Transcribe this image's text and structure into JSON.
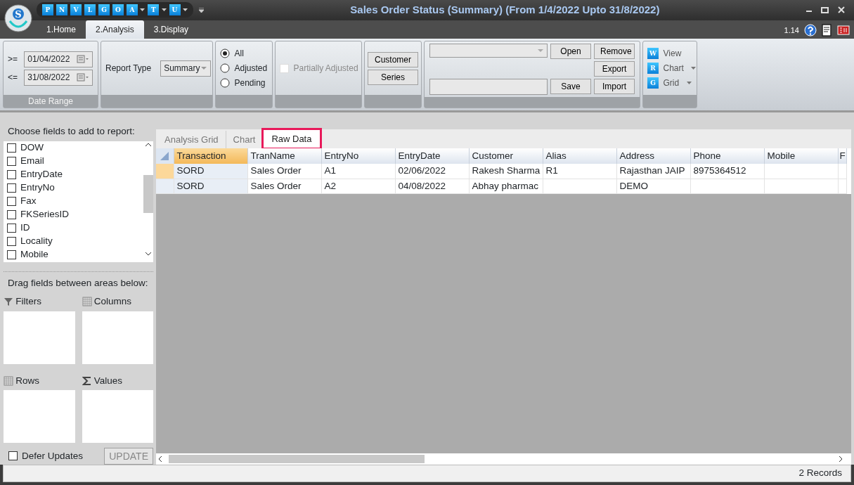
{
  "window": {
    "title": "Sales Order Status (Summary)  (From 1/4/2022 Upto 31/8/2022)",
    "logo_letter": "S"
  },
  "quick_access": [
    {
      "label": "P",
      "dropdown": false
    },
    {
      "label": "N",
      "dropdown": false
    },
    {
      "label": "V",
      "dropdown": false
    },
    {
      "label": "L",
      "dropdown": false
    },
    {
      "label": "G",
      "dropdown": false
    },
    {
      "label": "O",
      "dropdown": false
    },
    {
      "label": "A",
      "dropdown": true
    },
    {
      "label": "T",
      "dropdown": true
    },
    {
      "label": "U",
      "dropdown": true
    }
  ],
  "ribbon_tabs": [
    {
      "label": "1.Home",
      "selected": false
    },
    {
      "label": "2.Analysis",
      "selected": true
    },
    {
      "label": "3.Display",
      "selected": false
    }
  ],
  "version": "1.14",
  "ribbon": {
    "date_range": {
      "from_label": ">=",
      "from": "01/04/2022",
      "to_label": "<=",
      "to": "31/08/2022",
      "group_label": "Date Range"
    },
    "report_type": {
      "label": "Report Type",
      "value": "Summary"
    },
    "filter_options": [
      {
        "label": "All",
        "selected": true
      },
      {
        "label": "Adjusted",
        "selected": false
      },
      {
        "label": "Pending",
        "selected": false
      }
    ],
    "partially_adjusted": {
      "label": "Partially Adjusted",
      "checked": false,
      "disabled": true
    },
    "select_buttons": [
      "Customer",
      "Series"
    ],
    "layout": {
      "open": "Open",
      "remove": "Remove",
      "export": "Export",
      "save": "Save",
      "import": "Import"
    },
    "view_buttons": [
      {
        "letter": "W",
        "label": "View",
        "dropdown": false
      },
      {
        "letter": "R",
        "label": "Chart",
        "dropdown": true
      },
      {
        "letter": "G",
        "label": "Grid",
        "dropdown": true
      }
    ]
  },
  "field_list": {
    "title": "Choose fields to add to report:",
    "fields": [
      {
        "label": "DOW",
        "checked": false
      },
      {
        "label": "Email",
        "checked": false
      },
      {
        "label": "EntryDate",
        "checked": false
      },
      {
        "label": "EntryNo",
        "checked": false
      },
      {
        "label": "Fax",
        "checked": false
      },
      {
        "label": "FKSeriesID",
        "checked": false
      },
      {
        "label": "ID",
        "checked": false
      },
      {
        "label": "Locality",
        "checked": false
      },
      {
        "label": "Mobile",
        "checked": false
      }
    ],
    "drag_hint": "Drag fields between areas below:",
    "areas": [
      {
        "kind": "filter",
        "label": "Filters"
      },
      {
        "kind": "columns",
        "label": "Columns"
      },
      {
        "kind": "rows",
        "label": "Rows"
      },
      {
        "kind": "values",
        "label": "Values"
      }
    ],
    "defer_updates": {
      "label": "Defer Updates",
      "checked": false
    },
    "update_button": "UPDATE"
  },
  "grid": {
    "tabs": [
      {
        "label": "Analysis Grid",
        "selected": false
      },
      {
        "label": "Chart",
        "selected": false
      },
      {
        "label": "Raw Data",
        "selected": true
      }
    ],
    "columns": [
      "Transaction",
      "TranName",
      "EntryNo",
      "EntryDate",
      "Customer",
      "Alias",
      "Address",
      "Phone",
      "Mobile",
      "F"
    ],
    "rows": [
      {
        "current": true,
        "cells": [
          "SORD",
          "Sales Order",
          "A1",
          "02/06/2022",
          "Rakesh Sharma",
          "R1",
          "Rajasthan  JAIP",
          "8975364512",
          "",
          ""
        ]
      },
      {
        "current": false,
        "cells": [
          "SORD",
          "Sales Order",
          "A2",
          "04/08/2022",
          "Abhay pharmac",
          "",
          "DEMO",
          "",
          "",
          ""
        ]
      }
    ]
  },
  "status_bar": "2 Records"
}
